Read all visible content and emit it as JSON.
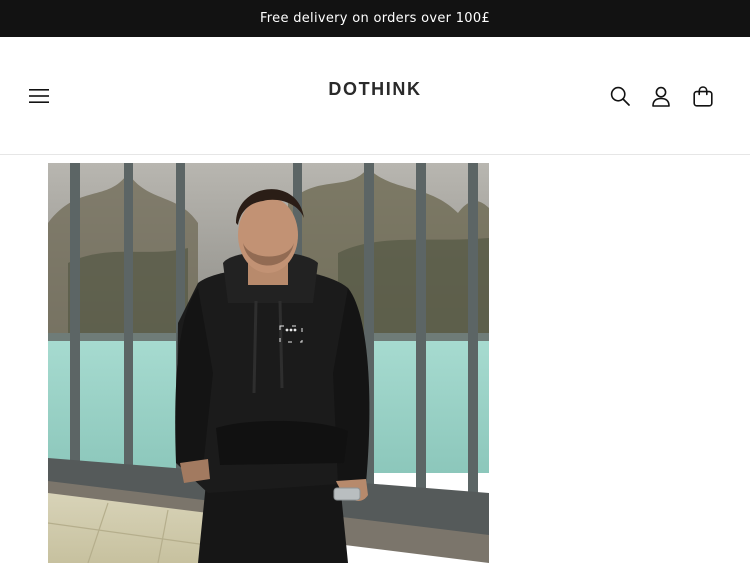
{
  "announcement": {
    "text": "Free delivery on orders over 100£"
  },
  "header": {
    "logo_text": "DOTHINK",
    "icons": {
      "menu": "hamburger-menu-icon",
      "search": "search-icon",
      "account": "user-account-icon",
      "cart": "shopping-bag-icon"
    }
  },
  "product": {
    "image": {
      "subject": "man in black hooded sweatshirt",
      "chest_logo_text": "DOTHINK"
    }
  },
  "colors": {
    "announcement_bg": "#121212",
    "text": "#121212",
    "background": "#ffffff",
    "divider": "#e6e6e6"
  }
}
